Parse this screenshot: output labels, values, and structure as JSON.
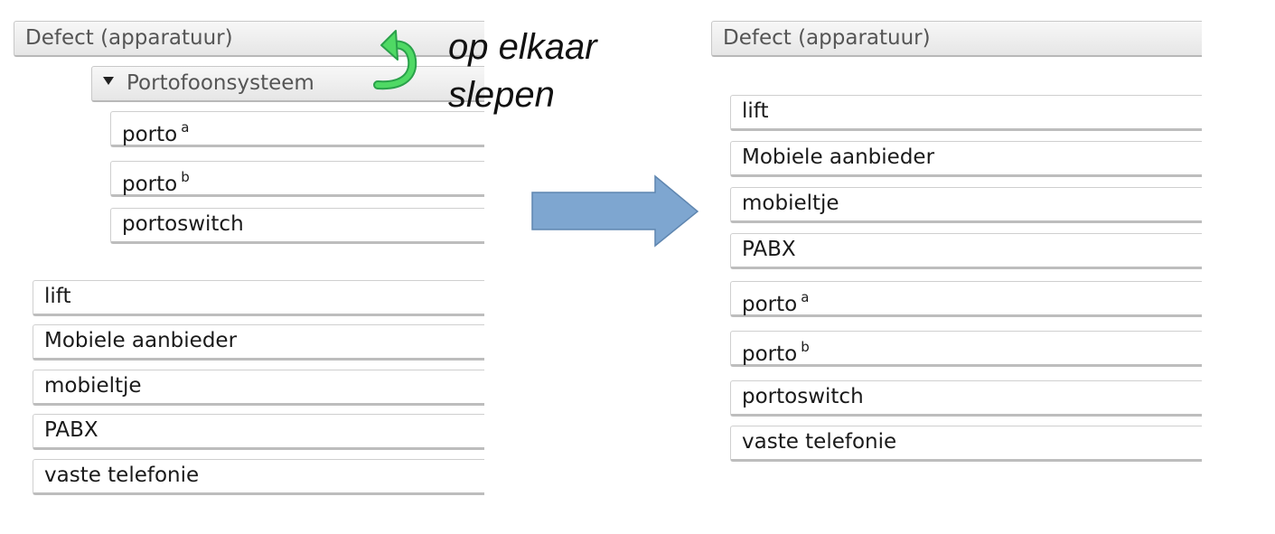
{
  "left": {
    "category": "Defect (apparatuur)",
    "subcategory": "Portofoonsysteem",
    "sub_items": [
      {
        "label": "porto",
        "sup": "a"
      },
      {
        "label": "porto",
        "sup": "b"
      },
      {
        "label": "portoswitch",
        "sup": ""
      }
    ],
    "items": [
      "lift",
      "Mobiele aanbieder",
      "mobieltje",
      "PABX",
      "vaste telefonie"
    ]
  },
  "instruction": {
    "line1": "op elkaar",
    "line2": "slepen"
  },
  "right": {
    "category": "Defect (apparatuur)",
    "items": [
      {
        "label": "lift",
        "sup": ""
      },
      {
        "label": "Mobiele aanbieder",
        "sup": ""
      },
      {
        "label": "mobieltje",
        "sup": ""
      },
      {
        "label": "PABX",
        "sup": ""
      },
      {
        "label": "porto",
        "sup": "a"
      },
      {
        "label": "porto",
        "sup": "b"
      },
      {
        "label": "portoswitch",
        "sup": ""
      },
      {
        "label": "vaste telefonie",
        "sup": ""
      }
    ]
  },
  "colors": {
    "curved_arrow": "#4fd964",
    "big_arrow": "#7ea6d0"
  },
  "icons": [
    "collapse-triangle-icon",
    "curved-arrow-icon",
    "right-arrow-icon"
  ]
}
